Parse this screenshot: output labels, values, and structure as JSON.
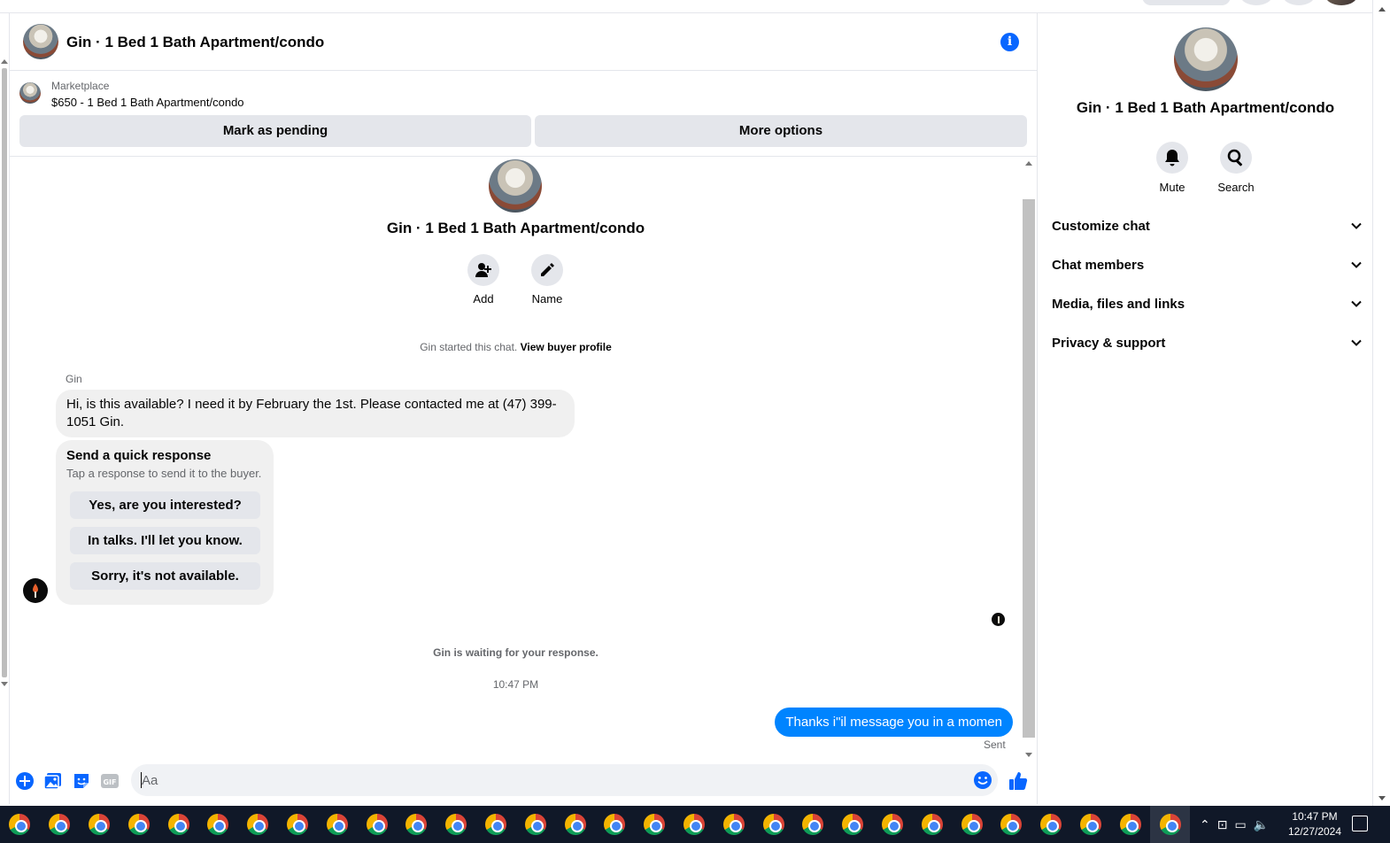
{
  "chat": {
    "title": "Gin · 1 Bed 1 Bath Apartment/condo",
    "marketplace_label": "Marketplace",
    "listing": "$650 - 1 Bed 1 Bath Apartment/condo",
    "mark_pending": "Mark as pending",
    "more_options": "More options"
  },
  "intro": {
    "title": "Gin · 1 Bed 1 Bath Apartment/condo",
    "add_label": "Add",
    "name_label": "Name",
    "started_text": "Gin started this chat.",
    "view_profile": "View buyer profile"
  },
  "messages": {
    "sender": "Gin",
    "incoming": "Hi, is this available? I need it by February the 1st. Please contacted me at (47) 399-1051 Gin.",
    "quick_title": "Send a quick response",
    "quick_subtitle": "Tap a response to send it to the buyer.",
    "quick_responses": [
      "Yes, are you interested?",
      "In talks. I'll let you know.",
      "Sorry, it's not available."
    ],
    "waiting": "Gin is waiting for your response.",
    "time": "10:47 PM",
    "outgoing": "Thanks i\"il message you in a momen",
    "status": "Sent"
  },
  "composer": {
    "placeholder": "Aa",
    "gif_label": "GIF"
  },
  "sidebar": {
    "title": "Gin · 1 Bed 1 Bath Apartment/condo",
    "mute_label": "Mute",
    "search_label": "Search",
    "sections": [
      "Customize chat",
      "Chat members",
      "Media, files and links",
      "Privacy & support"
    ]
  },
  "taskbar": {
    "time": "10:47 PM",
    "date": "12/27/2024",
    "icon_count": 30
  },
  "colors": {
    "accent": "#0866ff",
    "outgoing_bubble": "#0084ff",
    "taskbar": "#101828"
  }
}
